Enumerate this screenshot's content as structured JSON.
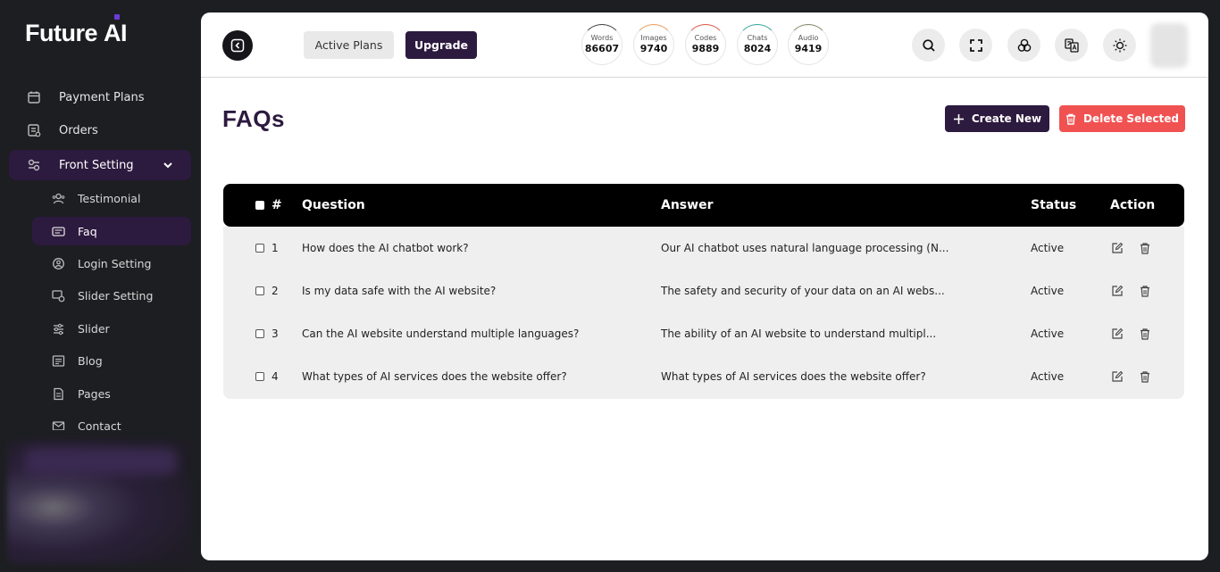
{
  "app": {
    "logo": "Future AI",
    "logo_main": "Future",
    "logo_ai": "AI"
  },
  "sidebar": {
    "items": [
      {
        "label": "Payment Plans",
        "icon": "payment-plans-icon"
      },
      {
        "label": "Orders",
        "icon": "orders-icon"
      },
      {
        "label": "Front Setting",
        "icon": "front-setting-icon",
        "expanded": true
      }
    ],
    "sub_items": [
      {
        "label": "Testimonial",
        "icon": "testimonial-icon"
      },
      {
        "label": "Faq",
        "icon": "faq-icon",
        "active": true
      },
      {
        "label": "Login Setting",
        "icon": "login-setting-icon"
      },
      {
        "label": "Slider Setting",
        "icon": "slider-setting-icon"
      },
      {
        "label": "Slider",
        "icon": "slider-icon"
      },
      {
        "label": "Blog",
        "icon": "blog-icon"
      },
      {
        "label": "Pages",
        "icon": "pages-icon"
      },
      {
        "label": "Contact",
        "icon": "contact-icon"
      }
    ]
  },
  "header": {
    "active_plans_label": "Active Plans",
    "upgrade_label": "Upgrade",
    "stats": [
      {
        "label": "Words",
        "value": "86607",
        "color": "#444444"
      },
      {
        "label": "Images",
        "value": "9740",
        "color": "#f0a060"
      },
      {
        "label": "Codes",
        "value": "9889",
        "color": "#e05a4a"
      },
      {
        "label": "Chats",
        "value": "8024",
        "color": "#3aa9a0"
      },
      {
        "label": "Audio",
        "value": "9419",
        "color": "#888866"
      }
    ],
    "icons": [
      "search-icon",
      "fullscreen-icon",
      "apps-icon",
      "translate-icon",
      "theme-icon"
    ]
  },
  "page": {
    "title": "FAQs",
    "create_label": "Create New",
    "delete_label": "Delete Selected"
  },
  "table": {
    "columns": {
      "num": "#",
      "question": "Question",
      "answer": "Answer",
      "status": "Status",
      "action": "Action"
    },
    "rows": [
      {
        "num": "1",
        "question": "How does the AI chatbot work?",
        "answer": "Our AI chatbot uses natural language processing (N...",
        "status": "Active"
      },
      {
        "num": "2",
        "question": "Is my data safe with the AI website?",
        "answer": "The safety and security of your data on an AI webs...",
        "status": "Active"
      },
      {
        "num": "3",
        "question": "Can the AI website understand multiple languages?",
        "answer": "The ability of an AI website to understand multipl...",
        "status": "Active"
      },
      {
        "num": "4",
        "question": "What types of AI services does the website offer?",
        "answer": "What types of AI services does the website offer?",
        "status": "Active"
      }
    ]
  },
  "colors": {
    "brand": "#2d1a3f",
    "danger": "#f05252",
    "sidebar_bg": "#1d1e22"
  }
}
